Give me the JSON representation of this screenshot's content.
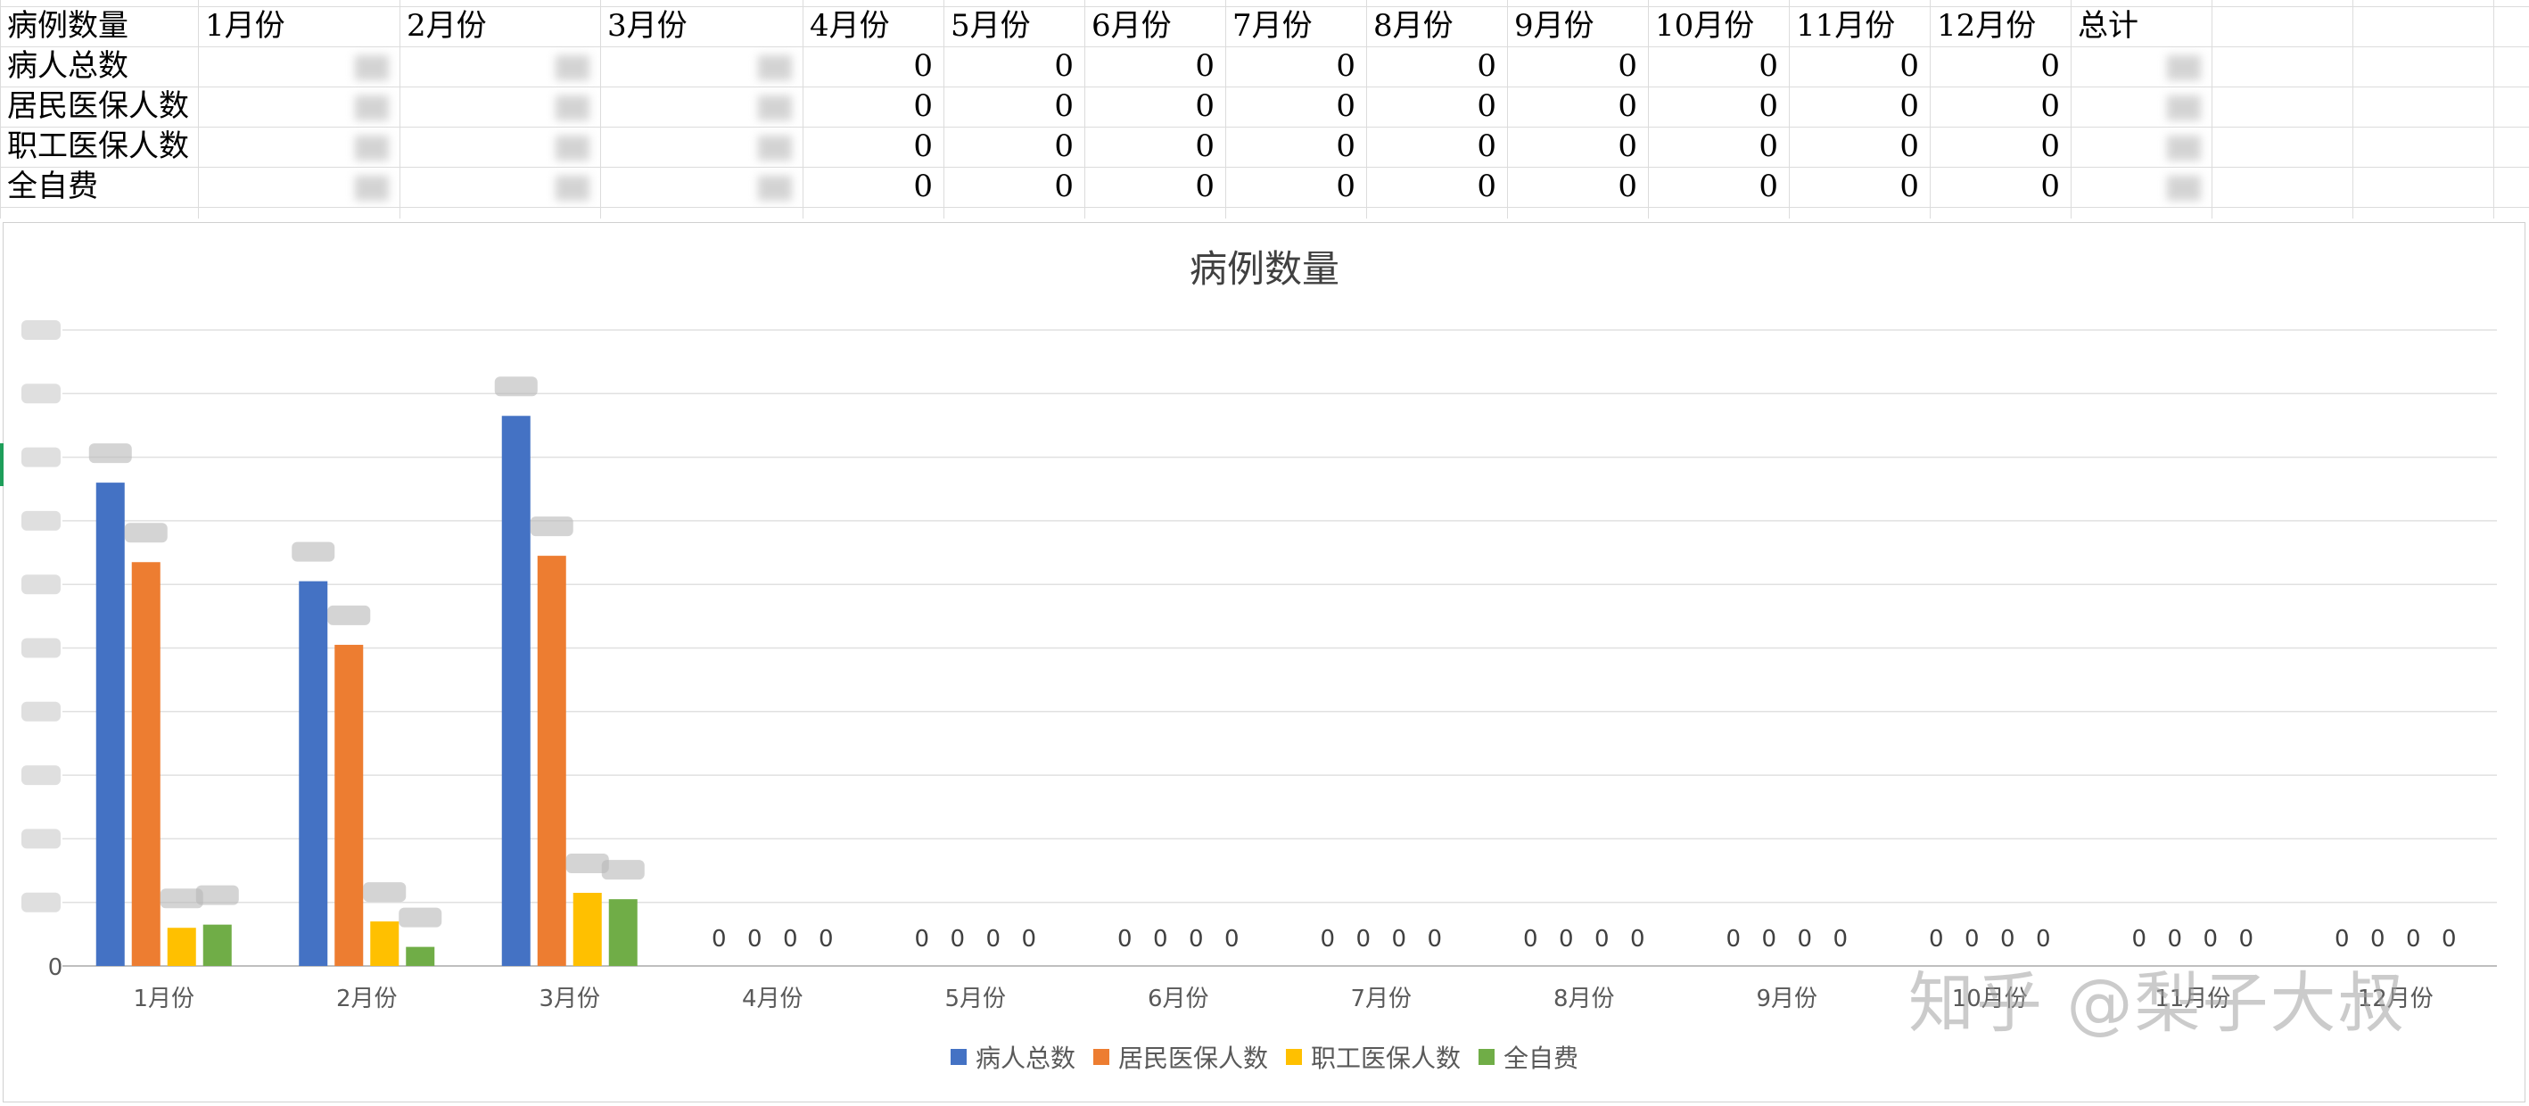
{
  "sheet": {
    "header": [
      "病例数量",
      "1月份",
      "2月份",
      "3月份",
      "4月份",
      "5月份",
      "6月份",
      "7月份",
      "8月份",
      "9月份",
      "10月份",
      "11月份",
      "12月份",
      "总计"
    ],
    "rows": [
      {
        "label": "病人总数",
        "values": [
          "",
          "",
          "",
          "0",
          "0",
          "0",
          "0",
          "0",
          "0",
          "0",
          "0",
          "0",
          ""
        ]
      },
      {
        "label": "居民医保人数",
        "values": [
          "",
          "",
          "",
          "0",
          "0",
          "0",
          "0",
          "0",
          "0",
          "0",
          "0",
          "0",
          ""
        ]
      },
      {
        "label": "职工医保人数",
        "values": [
          "",
          "",
          "",
          "0",
          "0",
          "0",
          "0",
          "0",
          "0",
          "0",
          "0",
          "0",
          ""
        ]
      },
      {
        "label": "全自费",
        "values": [
          "",
          "",
          "",
          "0",
          "0",
          "0",
          "0",
          "0",
          "0",
          "0",
          "0",
          "0",
          ""
        ]
      }
    ]
  },
  "chart_data": {
    "type": "bar",
    "title": "病例数量",
    "xlabel": "",
    "ylabel": "",
    "categories": [
      "1月份",
      "2月份",
      "3月份",
      "4月份",
      "5月份",
      "6月份",
      "7月份",
      "8月份",
      "9月份",
      "10月份",
      "11月份",
      "12月份"
    ],
    "series": [
      {
        "name": "病人总数",
        "color": "#4472C4",
        "values": [
          152,
          121,
          173,
          0,
          0,
          0,
          0,
          0,
          0,
          0,
          0,
          0
        ]
      },
      {
        "name": "居民医保人数",
        "color": "#ED7D31",
        "values": [
          127,
          101,
          129,
          0,
          0,
          0,
          0,
          0,
          0,
          0,
          0,
          0
        ]
      },
      {
        "name": "职工医保人数",
        "color": "#FFC000",
        "values": [
          12,
          14,
          23,
          0,
          0,
          0,
          0,
          0,
          0,
          0,
          0,
          0
        ]
      },
      {
        "name": "全自费",
        "color": "#70AD47",
        "values": [
          13,
          6,
          21,
          0,
          0,
          0,
          0,
          0,
          0,
          0,
          0,
          0
        ]
      }
    ],
    "ylim": [
      0,
      200
    ],
    "y_ticks_count": 10,
    "grid": true,
    "legend_position": "bottom",
    "data_labels_obscured": true,
    "y_tick_labels_obscured": true
  },
  "watermark": "知乎 @梨子大叔"
}
